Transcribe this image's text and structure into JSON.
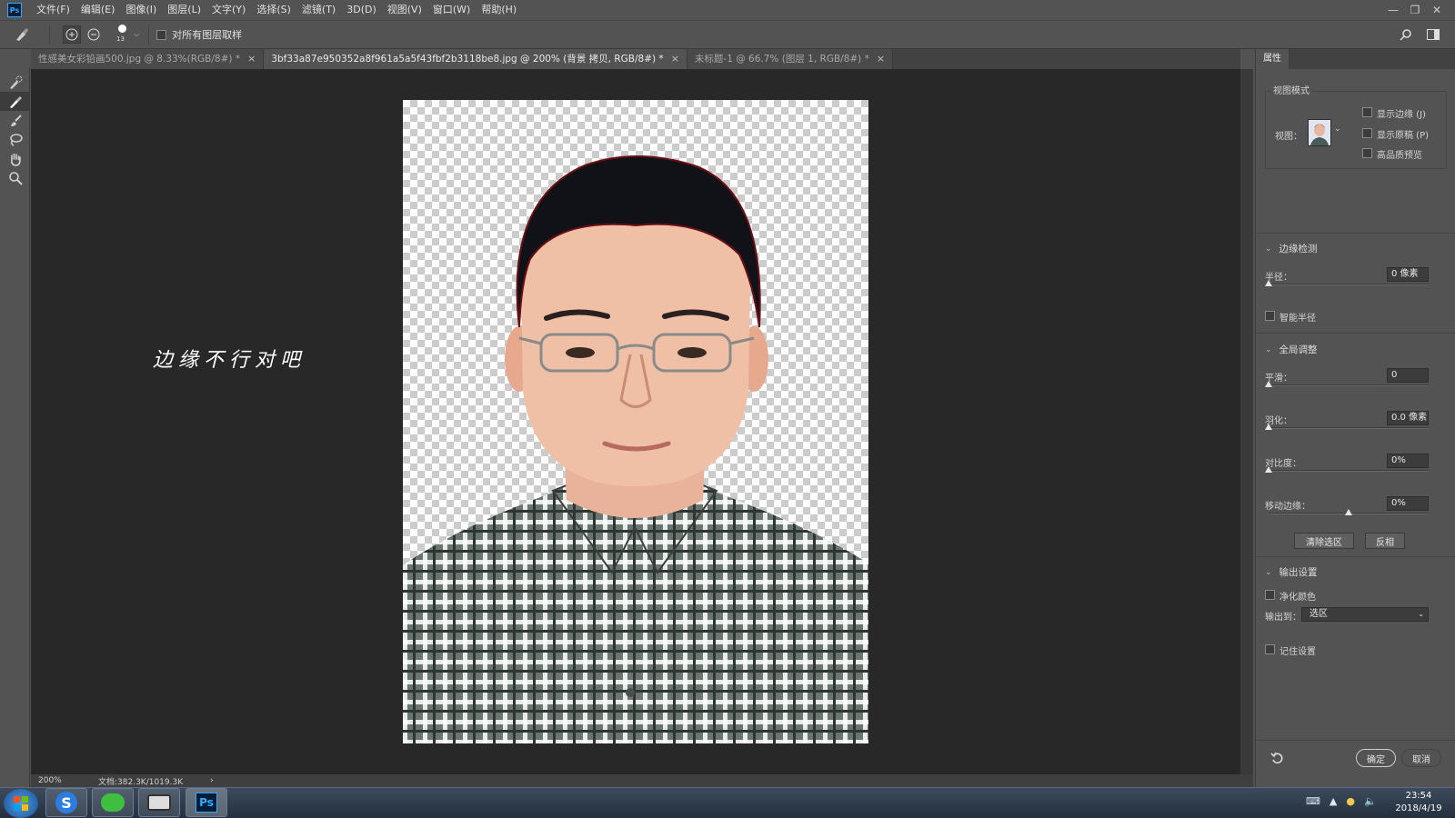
{
  "menu": [
    "文件(F)",
    "编辑(E)",
    "图像(I)",
    "图层(L)",
    "文字(Y)",
    "选择(S)",
    "滤镜(T)",
    "3D(D)",
    "视图(V)",
    "窗口(W)",
    "帮助(H)"
  ],
  "app_logo": "Ps",
  "options": {
    "brush_size": "13",
    "sample_all_layers": "对所有图层取样"
  },
  "tabs": [
    {
      "label": "性感美女彩铅画500.jpg @ 8.33%(RGB/8#) *",
      "active": false
    },
    {
      "label": "3bf33a87e950352a8f961a5a5f43fbf2b3118be8.jpg @ 200% (背景 拷贝, RGB/8#) *",
      "active": true
    },
    {
      "label": "未标题-1 @ 66.7% (图层 1, RGB/8#) *",
      "active": false
    }
  ],
  "annotation": "边缘不行对吧",
  "status": {
    "zoom": "200%",
    "doc": "文档:382.3K/1019.3K"
  },
  "panel": {
    "tab": "属性",
    "view_mode": {
      "title": "视图模式",
      "view_label": "视图：",
      "show_edge": "显示边缘 (J)",
      "show_original": "显示原稿 (P)",
      "hq_preview": "高品质预览"
    },
    "edge_detection": {
      "title": "边缘检测",
      "radius_label": "半径：",
      "radius_value": "0 像素",
      "radius_level": 0,
      "smart_radius": "智能半径"
    },
    "global": {
      "title": "全局调整",
      "smooth_label": "平滑：",
      "smooth_value": "0",
      "smooth_level": 0,
      "feather_label": "羽化：",
      "feather_value": "0.0 像素",
      "feather_level": 0,
      "contrast_label": "对比度：",
      "contrast_value": "0%",
      "contrast_level": 0,
      "shift_label": "移动边缘：",
      "shift_value": "0%",
      "shift_level": 0.5,
      "clear_btn": "清除选区",
      "invert_btn": "反相"
    },
    "output": {
      "title": "输出设置",
      "decontaminate": "净化颜色",
      "output_to_label": "输出到：",
      "output_to_value": "选区"
    },
    "remember": "记住设置",
    "ok": "确定",
    "cancel": "取消"
  },
  "taskbar": {
    "time": "23:54",
    "date": "2018/4/19",
    "ps_label": "Ps"
  }
}
